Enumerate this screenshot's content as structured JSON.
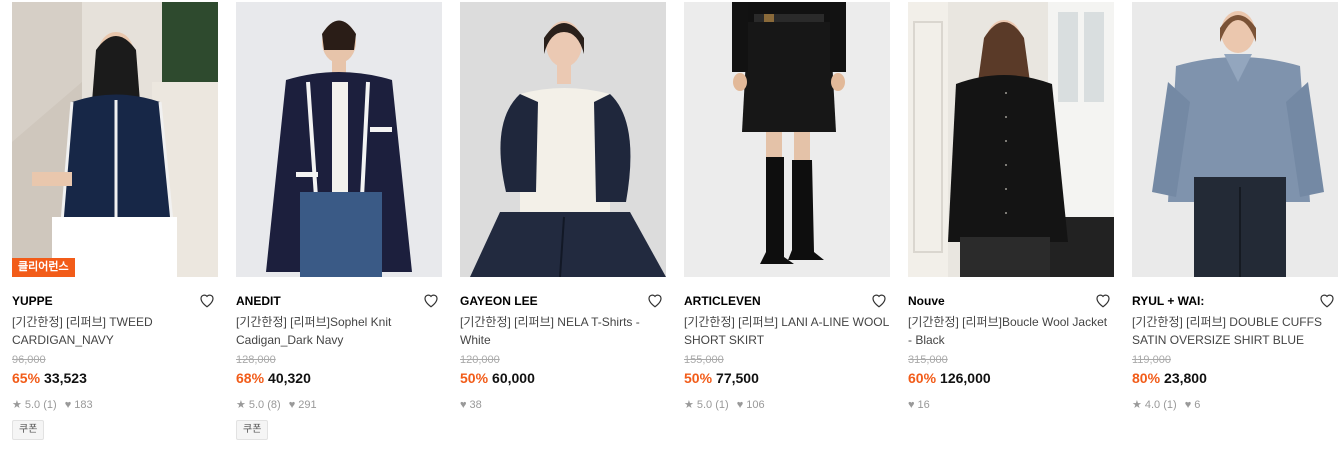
{
  "products": [
    {
      "brand": "YUPPE",
      "name": "[기간한정] [리퍼브] TWEED CARDIGAN_NAVY",
      "original_price": "96,000",
      "discount": "65%",
      "price": "33,523",
      "rating": "5.0",
      "reviews": "(1)",
      "likes": "183",
      "badge": "클리어런스",
      "coupon": "쿠폰"
    },
    {
      "brand": "ANEDIT",
      "name": "[기간한정] [리퍼브]Sophel Knit Cadigan_Dark Navy",
      "original_price": "128,000",
      "discount": "68%",
      "price": "40,320",
      "rating": "5.0",
      "reviews": "(8)",
      "likes": "291",
      "coupon": "쿠폰"
    },
    {
      "brand": "GAYEON LEE",
      "name": "[기간한정] [리퍼브] NELA T-Shirts - White",
      "original_price": "120,000",
      "discount": "50%",
      "price": "60,000",
      "likes": "38"
    },
    {
      "brand": "ARTICLEVEN",
      "name": "[기간한정] [리퍼브] LANI A-LINE WOOL SHORT SKIRT",
      "original_price": "155,000",
      "discount": "50%",
      "price": "77,500",
      "rating": "5.0",
      "reviews": "(1)",
      "likes": "106"
    },
    {
      "brand": "Nouve",
      "name": "[기간한정] [리퍼브]Boucle Wool Jacket - Black",
      "original_price": "315,000",
      "discount": "60%",
      "price": "126,000",
      "likes": "16"
    },
    {
      "brand": "RYUL + WAI:",
      "name": "[기간한정] [리퍼브] DOUBLE CUFFS SATIN OVERSIZE SHIRT BLUE",
      "original_price": "119,000",
      "discount": "80%",
      "price": "23,800",
      "rating": "4.0",
      "reviews": "(1)",
      "likes": "6"
    }
  ],
  "icons": {
    "wishlist": "heart-outline-icon",
    "rating": "star-icon",
    "likes": "heart-icon"
  },
  "colors": {
    "discount": "#f25c19",
    "badge": "#f25c19"
  }
}
